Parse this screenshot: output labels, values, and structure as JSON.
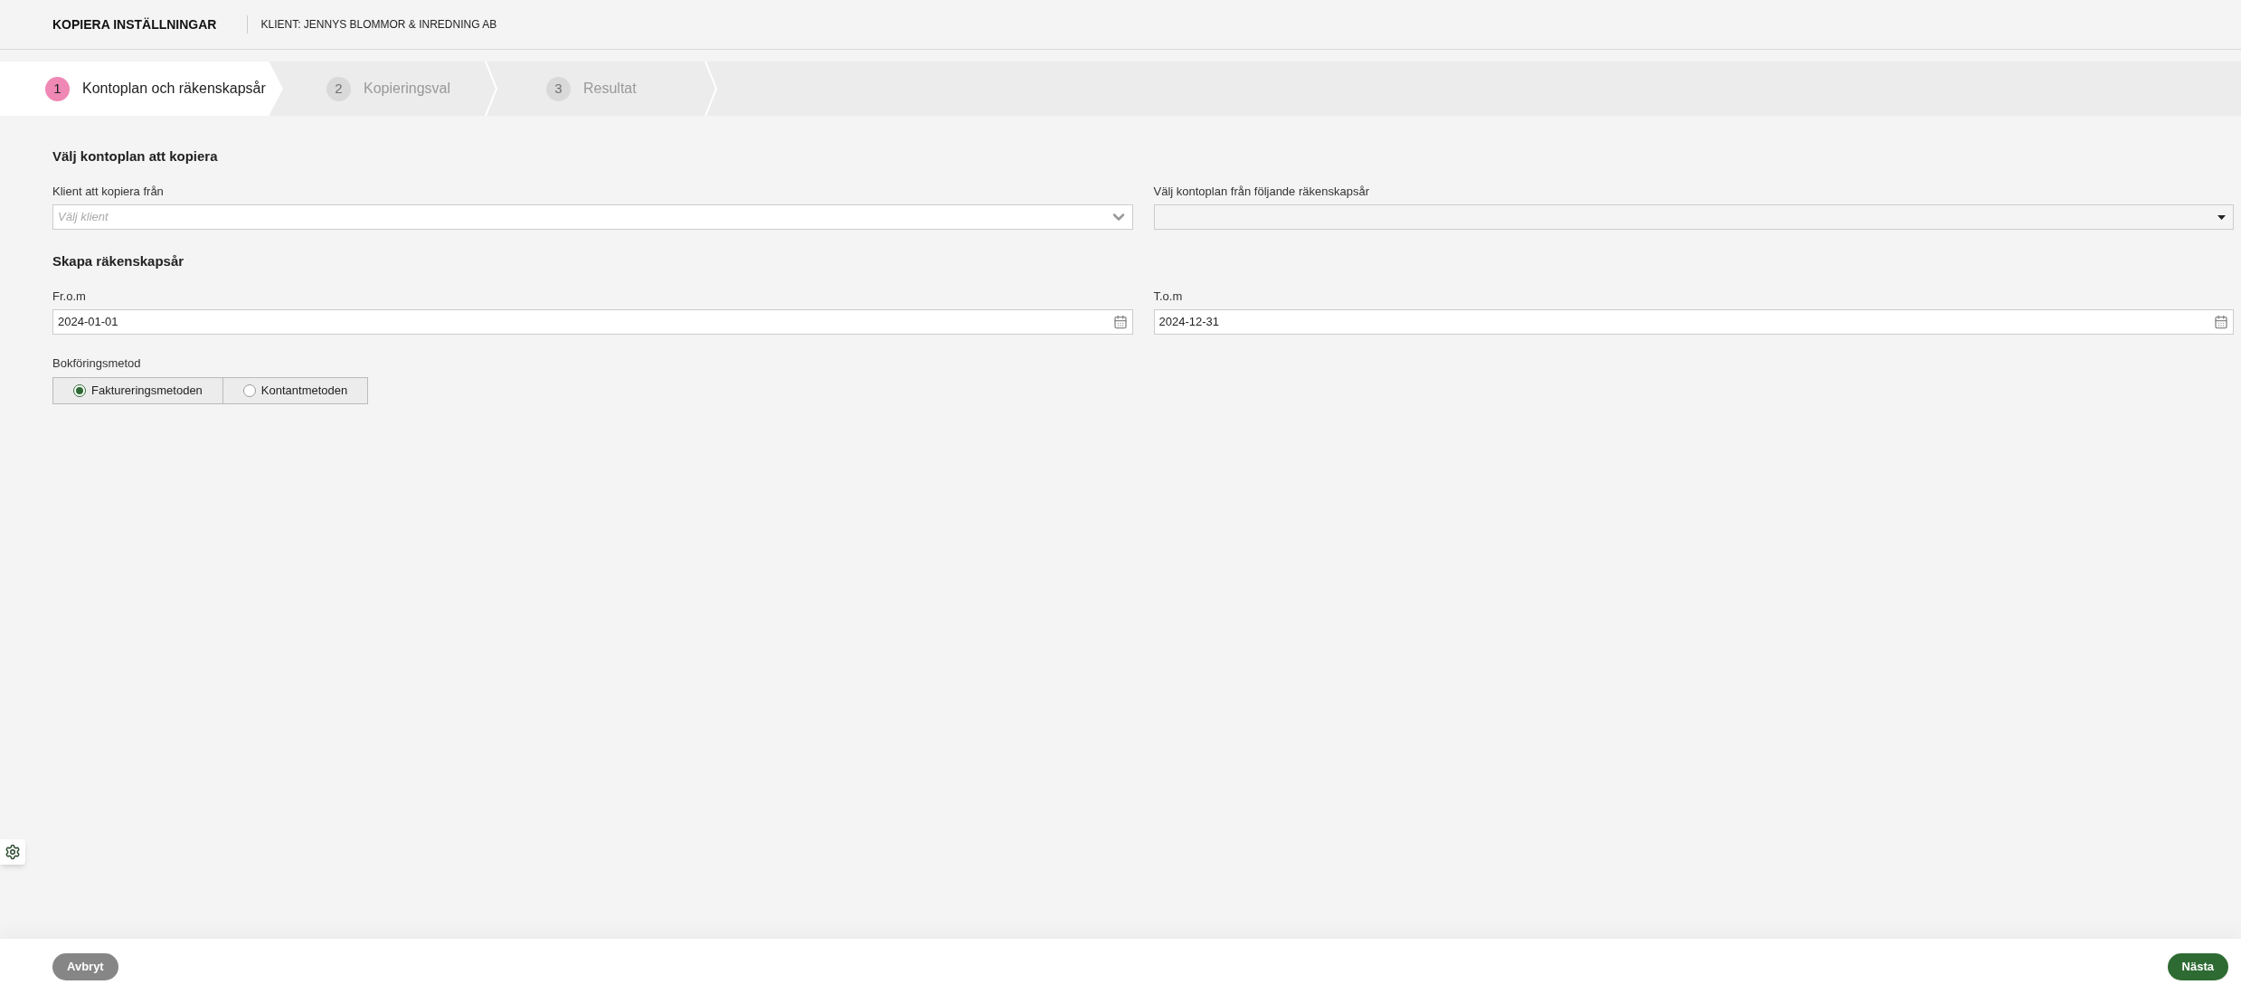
{
  "header": {
    "title": "KOPIERA INSTÄLLNINGAR",
    "client": "KLIENT: JENNYS BLOMMOR & INREDNING AB"
  },
  "steps": [
    {
      "number": "1",
      "label": "Kontoplan och räkenskapsår",
      "selected": true
    },
    {
      "number": "2",
      "label": "Kopieringsval",
      "selected": false
    },
    {
      "number": "3",
      "label": "Resultat",
      "selected": false
    }
  ],
  "section_copy": {
    "title": "Välj kontoplan att kopiera",
    "client_label": "Klient att kopiera från",
    "client_placeholder": "Välj klient",
    "year_label": "Välj kontoplan från följande räkenskapsår"
  },
  "section_year": {
    "title": "Skapa räkenskapsår",
    "from_label": "Fr.o.m",
    "from_value": "2024-01-01",
    "to_label": "T.o.m",
    "to_value": "2024-12-31"
  },
  "method": {
    "label": "Bokföringsmetod",
    "options": [
      {
        "label": "Faktureringsmetoden",
        "selected": true
      },
      {
        "label": "Kontantmetoden",
        "selected": false
      }
    ]
  },
  "footer": {
    "cancel": "Avbryt",
    "next": "Nästa"
  }
}
